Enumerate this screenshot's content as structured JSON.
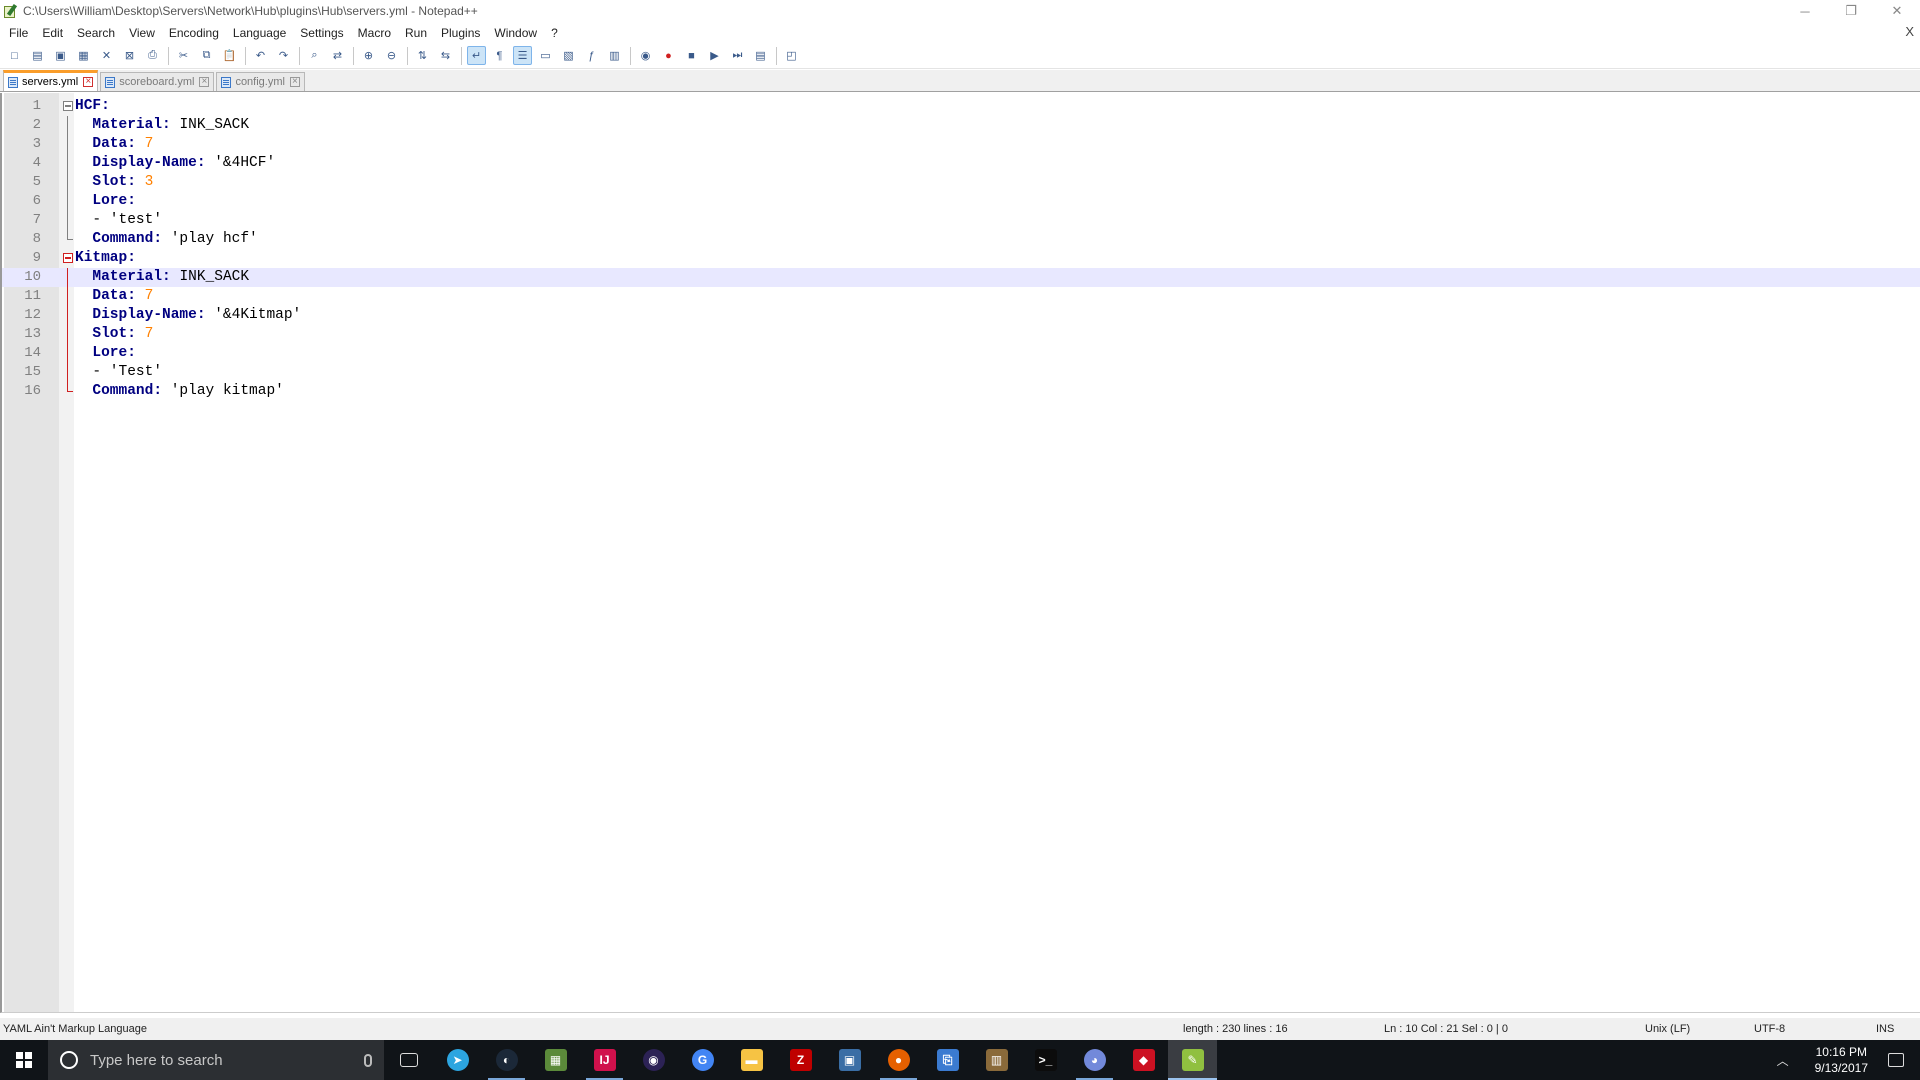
{
  "window": {
    "title": "C:\\Users\\William\\Desktop\\Servers\\Network\\Hub\\plugins\\Hub\\servers.yml - Notepad++",
    "minimize": "─",
    "restore": "❐",
    "close": "✕"
  },
  "menu": {
    "items": [
      "File",
      "Edit",
      "Search",
      "View",
      "Encoding",
      "Language",
      "Settings",
      "Macro",
      "Run",
      "Plugins",
      "Window",
      "?"
    ],
    "close_x": "X"
  },
  "toolbar": {
    "icons": [
      "new-file-icon",
      "open-file-icon",
      "save-icon",
      "save-all-icon",
      "close-icon",
      "close-all-icon",
      "print-icon",
      "cut-icon",
      "copy-icon",
      "paste-icon",
      "undo-icon",
      "redo-icon",
      "find-icon",
      "replace-icon",
      "zoom-in-icon",
      "zoom-out-icon",
      "sync-vertical-icon",
      "sync-horizontal-icon",
      "word-wrap-icon",
      "show-all-chars-icon",
      "indent-guide-icon",
      "user-lang-icon",
      "doc-map-icon",
      "function-list-icon",
      "folder-workspace-icon",
      "monitoring-icon",
      "record-macro-icon",
      "stop-record-icon",
      "playback-icon",
      "run-macro-multiple-icon",
      "save-macro-icon",
      "launch-browser-icon"
    ]
  },
  "tabs": [
    {
      "label": "servers.yml",
      "active": true
    },
    {
      "label": "scoreboard.yml",
      "active": false
    },
    {
      "label": "config.yml",
      "active": false
    }
  ],
  "editor": {
    "current_line": 10,
    "lines": [
      {
        "n": "1",
        "key": "HCF",
        "val": "",
        "type": "plain",
        "indent": 0
      },
      {
        "n": "2",
        "key": "Material",
        "val": "INK_SACK",
        "type": "plain",
        "indent": 2
      },
      {
        "n": "3",
        "key": "Data",
        "val": "7",
        "type": "num",
        "indent": 2
      },
      {
        "n": "4",
        "key": "Display-Name",
        "val": "'&4HCF'",
        "type": "plain",
        "indent": 2
      },
      {
        "n": "5",
        "key": "Slot",
        "val": "3",
        "type": "num",
        "indent": 2
      },
      {
        "n": "6",
        "key": "Lore",
        "val": "",
        "type": "plain",
        "indent": 2
      },
      {
        "n": "7",
        "key": "",
        "val": "- 'test'",
        "type": "item",
        "indent": 2
      },
      {
        "n": "8",
        "key": "Command",
        "val": "'play hcf'",
        "type": "plain",
        "indent": 2
      },
      {
        "n": "9",
        "key": "Kitmap",
        "val": "",
        "type": "plain",
        "indent": 0
      },
      {
        "n": "10",
        "key": "Material",
        "val": "INK_SACK",
        "type": "plain",
        "indent": 2
      },
      {
        "n": "11",
        "key": "Data",
        "val": "7",
        "type": "num",
        "indent": 2
      },
      {
        "n": "12",
        "key": "Display-Name",
        "val": "'&4Kitmap'",
        "type": "plain",
        "indent": 2
      },
      {
        "n": "13",
        "key": "Slot",
        "val": "7",
        "type": "num",
        "indent": 2
      },
      {
        "n": "14",
        "key": "Lore",
        "val": "",
        "type": "plain",
        "indent": 2
      },
      {
        "n": "15",
        "key": "",
        "val": "- 'Test'",
        "type": "item",
        "indent": 2
      },
      {
        "n": "16",
        "key": "Command",
        "val": "'play kitmap'",
        "type": "plain",
        "indent": 2
      }
    ]
  },
  "statusbar": {
    "language": "YAML Ain't Markup Language",
    "length": "length : 230    lines : 16",
    "position": "Ln : 10    Col : 21    Sel : 0 | 0",
    "eol": "Unix (LF)",
    "encoding": "UTF-8",
    "mode": "INS"
  },
  "taskbar": {
    "search_placeholder": "Type here to search",
    "apps": [
      {
        "name": "task-view-icon",
        "color": "#101418",
        "glyph": "▭",
        "running": false
      },
      {
        "name": "telegram-icon",
        "color": "#2ca5e0",
        "glyph": "➤",
        "running": false
      },
      {
        "name": "steam-icon",
        "color": "#1b2838",
        "glyph": "◐",
        "running": true
      },
      {
        "name": "minecraft-icon",
        "color": "#5b8a3a",
        "glyph": "▦",
        "running": false
      },
      {
        "name": "intellij-icon",
        "color": "#d0114c",
        "glyph": "IJ",
        "running": true
      },
      {
        "name": "eclipse-icon",
        "color": "#2c2255",
        "glyph": "◉",
        "running": false
      },
      {
        "name": "chrome-icon",
        "color": "#4285f4",
        "glyph": "G",
        "running": false
      },
      {
        "name": "file-explorer-icon",
        "color": "#f6c344",
        "glyph": "▬",
        "running": false
      },
      {
        "name": "filezilla-icon",
        "color": "#bf0000",
        "glyph": "Z",
        "running": false
      },
      {
        "name": "remote-desktop-icon",
        "color": "#3a6ea5",
        "glyph": "▣",
        "running": false
      },
      {
        "name": "firefox-icon",
        "color": "#e66000",
        "glyph": "●",
        "running": true
      },
      {
        "name": "network-icon",
        "color": "#3b7bd1",
        "glyph": "⎘",
        "running": false
      },
      {
        "name": "package-icon",
        "color": "#8a6a3a",
        "glyph": "▥",
        "running": false
      },
      {
        "name": "terminal-icon",
        "color": "#0c0c0c",
        "glyph": ">_",
        "running": false
      },
      {
        "name": "discord-icon",
        "color": "#7289da",
        "glyph": "◕",
        "running": true
      },
      {
        "name": "ruby-icon",
        "color": "#cc1122",
        "glyph": "◆",
        "running": false
      },
      {
        "name": "notepadpp-icon",
        "color": "#90c040",
        "glyph": "✎",
        "running": true,
        "active": true
      }
    ],
    "time": "10:16 PM",
    "date": "9/13/2017"
  }
}
